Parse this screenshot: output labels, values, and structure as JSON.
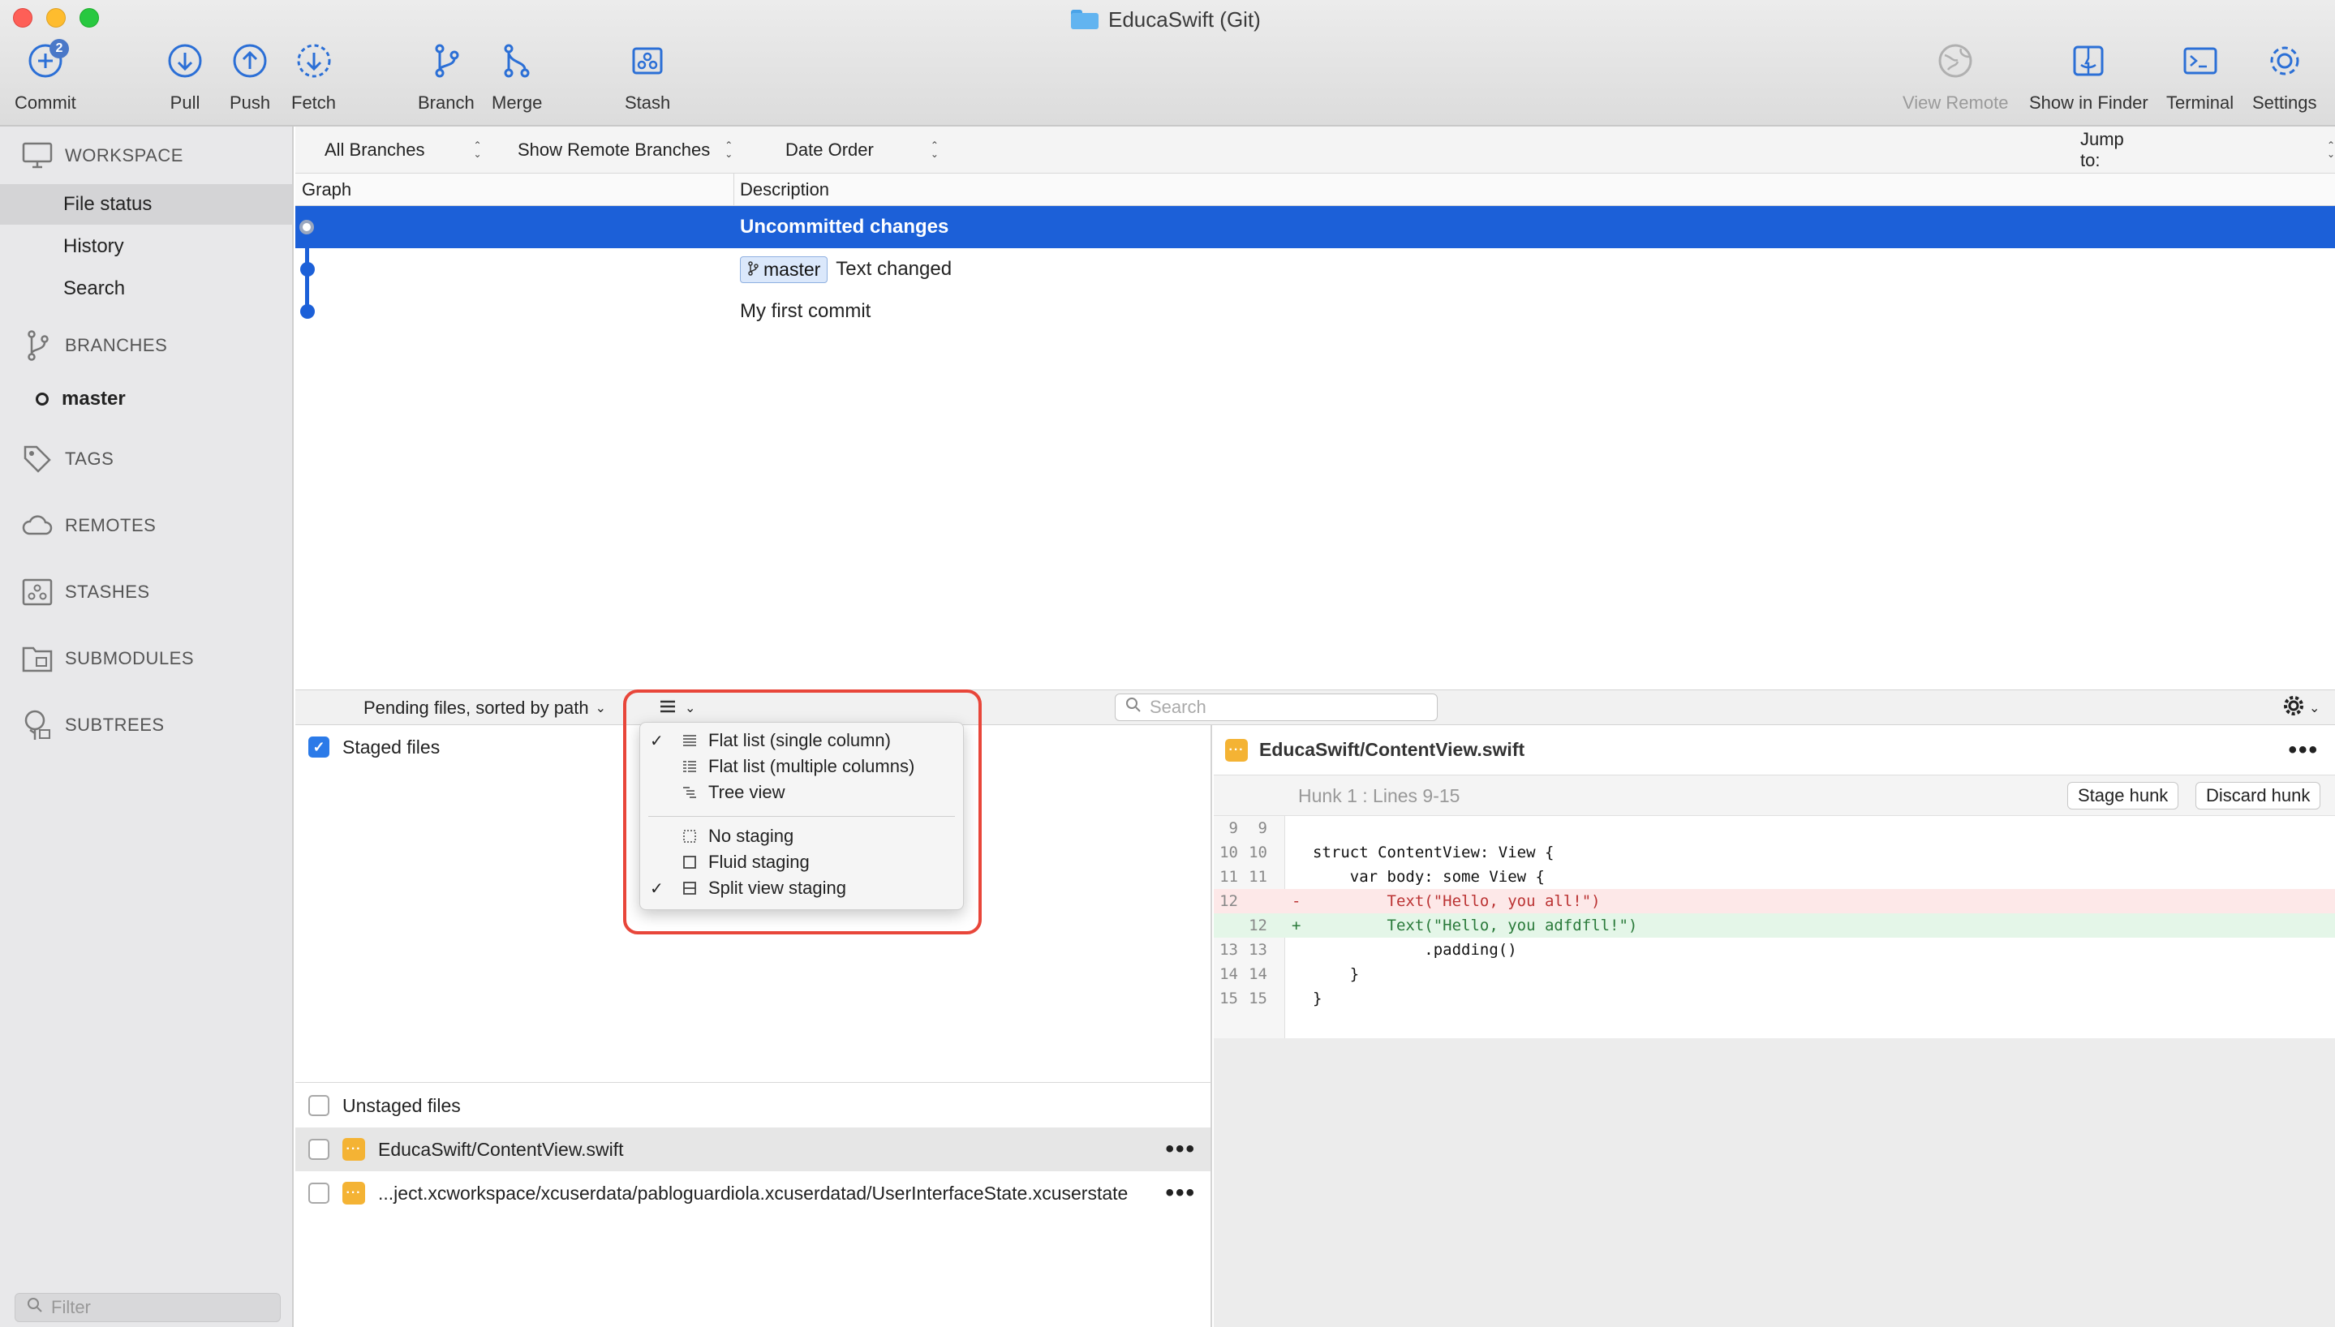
{
  "window": {
    "title": "EducaSwift (Git)"
  },
  "toolbar": {
    "commit": "Commit",
    "commit_badge": "2",
    "pull": "Pull",
    "push": "Push",
    "fetch": "Fetch",
    "branch": "Branch",
    "merge": "Merge",
    "stash": "Stash",
    "view_remote": "View Remote",
    "show_in_finder": "Show in Finder",
    "terminal": "Terminal",
    "settings": "Settings"
  },
  "sidebar": {
    "workspace": "WORKSPACE",
    "items": [
      "File status",
      "History",
      "Search"
    ],
    "branches": "BRANCHES",
    "branch_current": "master",
    "tags": "TAGS",
    "remotes": "REMOTES",
    "stashes": "STASHES",
    "submodules": "SUBMODULES",
    "subtrees": "SUBTREES",
    "filter_placeholder": "Filter"
  },
  "filters": {
    "branches": "All Branches",
    "remote": "Show Remote Branches",
    "order": "Date Order",
    "jump": "Jump to:"
  },
  "log": {
    "col_graph": "Graph",
    "col_description": "Description",
    "commits": [
      {
        "description": "Uncommitted changes"
      },
      {
        "branch": "master",
        "description": "Text changed"
      },
      {
        "description": "My first commit"
      }
    ]
  },
  "pending": {
    "label": "Pending files, sorted by path",
    "search_placeholder": "Search",
    "staged_label": "Staged files",
    "unstaged_label": "Unstaged files",
    "files": [
      {
        "path": "EducaSwift/ContentView.swift"
      },
      {
        "path": "...ject.xcworkspace/xcuserdata/pabloguardiola.xcuserdatad/UserInterfaceState.xcuserstate"
      }
    ]
  },
  "menu": {
    "items": [
      {
        "label": "Flat list (single column)",
        "checked": true
      },
      {
        "label": "Flat list (multiple columns)",
        "checked": false
      },
      {
        "label": "Tree view",
        "checked": false
      },
      {
        "label": "No staging",
        "checked": false
      },
      {
        "label": "Fluid staging",
        "checked": false
      },
      {
        "label": "Split view staging",
        "checked": true
      }
    ]
  },
  "diff": {
    "file": "EducaSwift/ContentView.swift",
    "hunk_title": "Hunk 1 : Lines 9-15",
    "stage_hunk": "Stage hunk",
    "discard_hunk": "Discard hunk",
    "lines": [
      {
        "old": "9",
        "new": "9",
        "sign": "",
        "text": ""
      },
      {
        "old": "10",
        "new": "10",
        "sign": "",
        "text": "struct ContentView: View {"
      },
      {
        "old": "11",
        "new": "11",
        "sign": "",
        "text": "    var body: some View {"
      },
      {
        "old": "12",
        "new": "",
        "sign": "-",
        "text": "        Text(\"Hello, you all!\")"
      },
      {
        "old": "",
        "new": "12",
        "sign": "+",
        "text": "        Text(\"Hello, you adfdfll!\")"
      },
      {
        "old": "13",
        "new": "13",
        "sign": "",
        "text": "            .padding()"
      },
      {
        "old": "14",
        "new": "14",
        "sign": "",
        "text": "    }"
      },
      {
        "old": "15",
        "new": "15",
        "sign": "",
        "text": "}"
      }
    ]
  },
  "colors": {
    "accent": "#1c60d8",
    "highlight_box": "#e8463a",
    "modified": "#f4b334"
  }
}
